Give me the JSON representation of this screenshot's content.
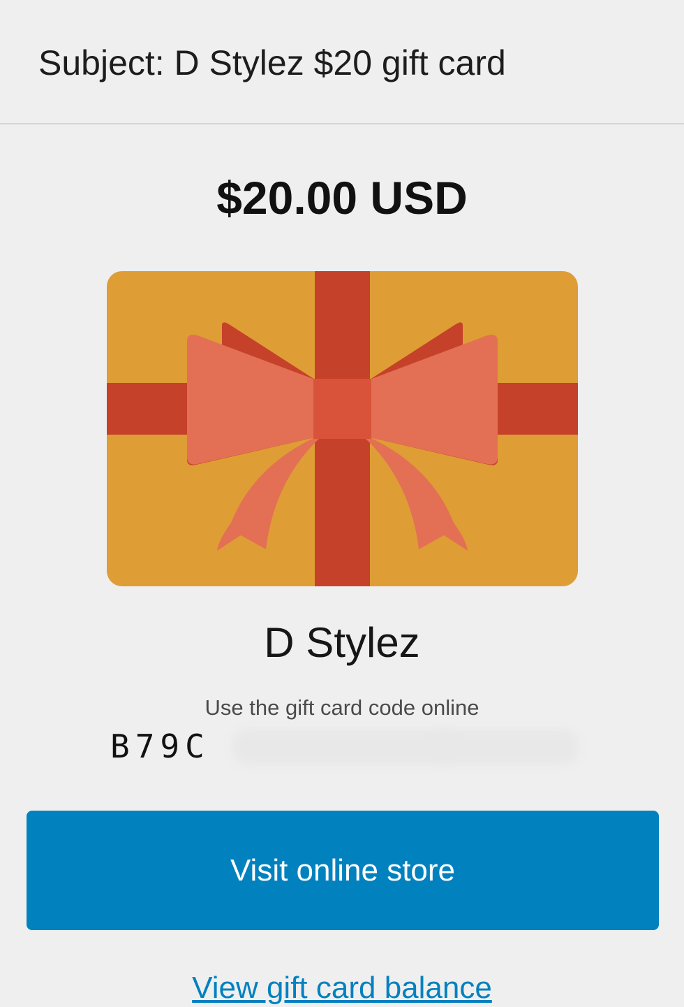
{
  "email": {
    "subject": "Subject: D Stylez $20 gift card"
  },
  "gift_card": {
    "amount": "$20.00 USD",
    "store_name": "D Stylez",
    "code_hint": "Use the gift card code online",
    "code_visible": "B79C",
    "image_icon": "gift-bow-icon",
    "colors": {
      "card": "#df9d35",
      "ribbon": "#c5412a",
      "bow": "#e37055",
      "knot": "#d9533b"
    }
  },
  "actions": {
    "visit_store_label": "Visit online store",
    "view_balance_label": "View gift card balance",
    "button_color": "#0281bf"
  }
}
